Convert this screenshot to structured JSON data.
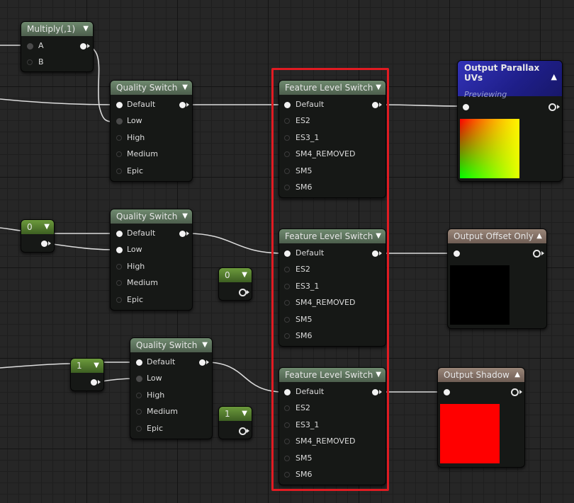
{
  "multiply_node": {
    "title": "Multiply(,1)",
    "pin_a": "A",
    "pin_b": "B"
  },
  "quality_switch": {
    "title": "Quality Switch",
    "pins": [
      "Default",
      "Low",
      "High",
      "Medium",
      "Epic"
    ]
  },
  "feature_level_switch": {
    "title": "Feature Level Switch",
    "pins": [
      "Default",
      "ES2",
      "ES3_1",
      "SM4_REMOVED",
      "SM5",
      "SM6"
    ]
  },
  "constants": {
    "zero": "0",
    "one": "1"
  },
  "outputs": {
    "parallax": {
      "title": "Output Parallax UVs",
      "subtitle": "Previewing"
    },
    "offset": {
      "title": "Output Offset Only"
    },
    "shadow": {
      "title": "Output Shadow"
    }
  },
  "colors": {
    "highlight": "#e11b22",
    "shadow_preview": "#ff0000",
    "offset_preview": "#000000",
    "parallax_header": "#2a2aa6"
  },
  "icons": {
    "expand": "chevron-down-icon",
    "collapse": "chevron-up-icon"
  }
}
